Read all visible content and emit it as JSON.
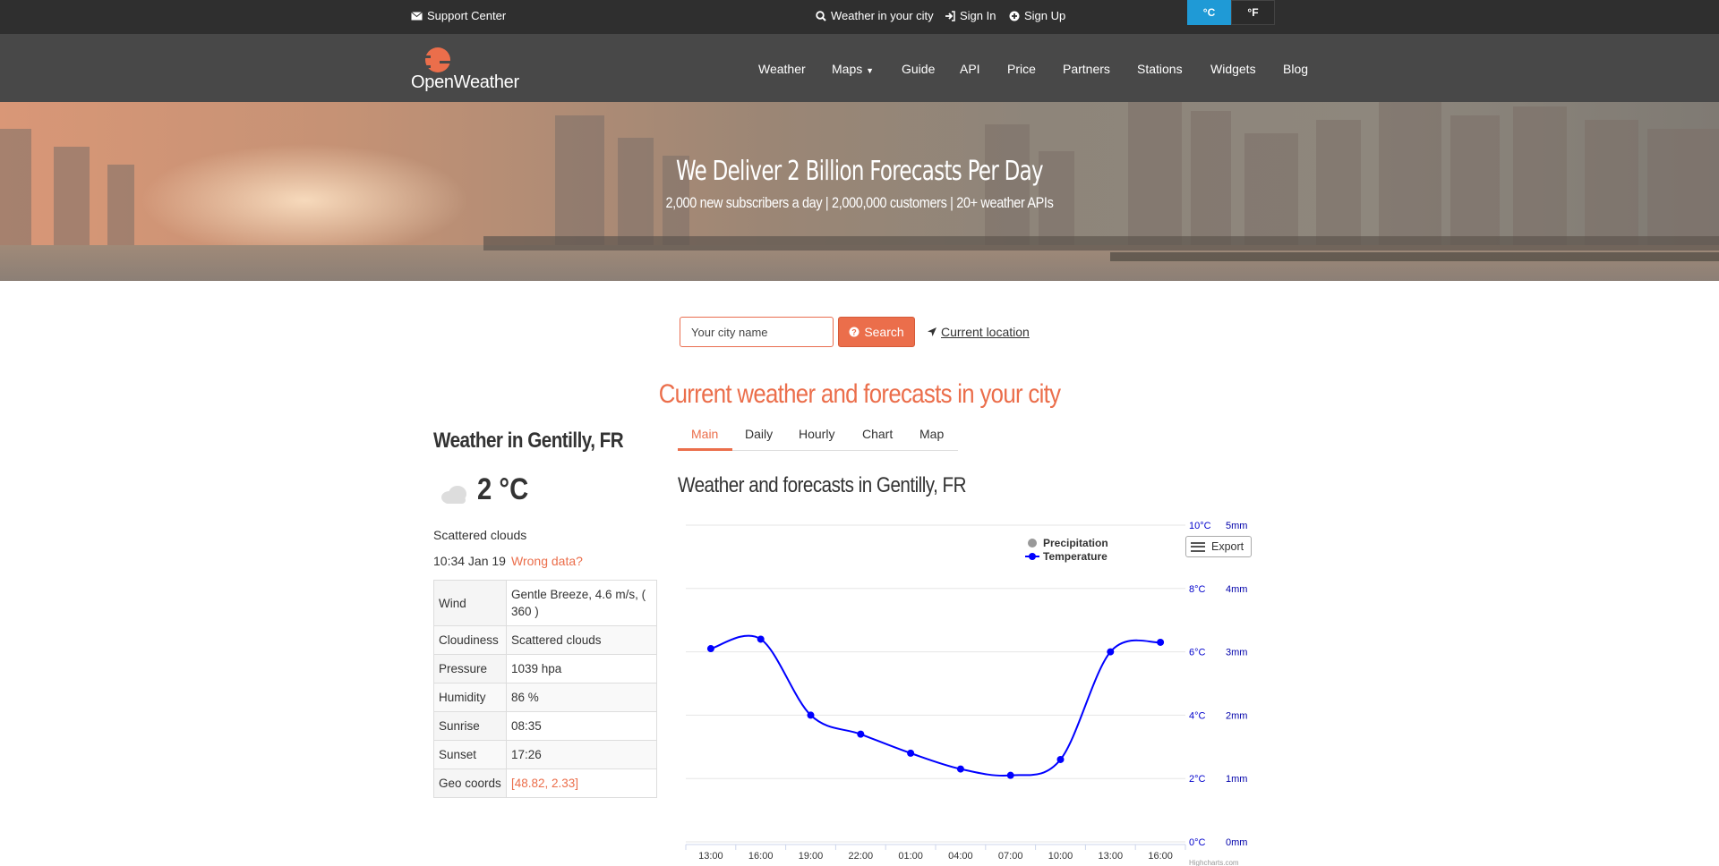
{
  "topbar": {
    "support": "Support Center",
    "weather_city": "Weather in your city",
    "sign_in": "Sign In",
    "sign_up": "Sign Up",
    "unit_c": "°C",
    "unit_f": "°F"
  },
  "nav": {
    "logo": "OpenWeather",
    "items": [
      "Weather",
      "Maps",
      "Guide",
      "API",
      "Price",
      "Partners",
      "Stations",
      "Widgets",
      "Blog"
    ]
  },
  "hero": {
    "title": "We Deliver 2 Billion Forecasts Per Day",
    "subtitle": "2,000 new subscribers a day | 2,000,000 customers | 20+ weather APIs"
  },
  "search": {
    "placeholder": "Your city name",
    "button": "Search",
    "current_location": "Current location"
  },
  "section_title": "Current weather and forecasts in your city",
  "current": {
    "city": "Weather in Gentilly, FR",
    "temp": "2 °C",
    "description": "Scattered clouds",
    "time": "10:34 Jan 19",
    "wrong_data": "Wrong data?",
    "details": [
      {
        "k": "Wind",
        "v": "Gentle Breeze, 4.6 m/s, ( 360 )"
      },
      {
        "k": "Cloudiness",
        "v": "Scattered clouds"
      },
      {
        "k": "Pressure",
        "v": "1039 hpa"
      },
      {
        "k": "Humidity",
        "v": "86 %"
      },
      {
        "k": "Sunrise",
        "v": "08:35"
      },
      {
        "k": "Sunset",
        "v": "17:26"
      },
      {
        "k": "Geo coords",
        "v": "[48.82, 2.33]"
      }
    ]
  },
  "tabs": [
    "Main",
    "Daily",
    "Hourly",
    "Chart",
    "Map"
  ],
  "chart_title": "Weather and forecasts in Gentilly, FR",
  "export": "Export",
  "chart_data": {
    "type": "line",
    "x": [
      "13:00",
      "16:00",
      "19:00",
      "22:00",
      "01:00",
      "04:00",
      "07:00",
      "10:00",
      "13:00",
      "16:00"
    ],
    "series": [
      {
        "name": "Temperature",
        "color": "#0000ff",
        "values": [
          6.1,
          6.4,
          4.0,
          3.4,
          2.8,
          2.3,
          2.1,
          2.6,
          6.0,
          6.3
        ]
      },
      {
        "name": "Precipitation",
        "color": "#999999",
        "values": []
      }
    ],
    "y_temp_ticks": [
      "10°C",
      "8°C",
      "6°C",
      "4°C",
      "2°C",
      "0°C"
    ],
    "y_temp_range": [
      0,
      10
    ],
    "y_precip_ticks": [
      "5mm",
      "4mm",
      "3mm",
      "2mm",
      "1mm",
      "0mm"
    ],
    "y_precip_range": [
      0,
      5
    ],
    "grid": true,
    "legend": "top-right",
    "credit": "Highcharts.com"
  }
}
